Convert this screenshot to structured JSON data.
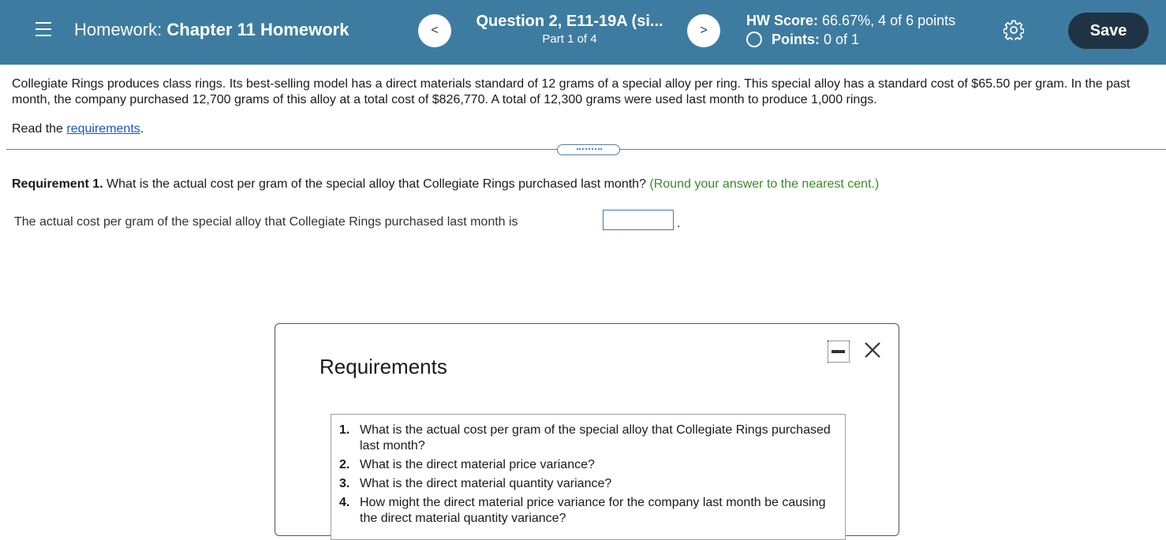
{
  "header": {
    "hw_prefix": "Homework:",
    "hw_title": "Chapter 11 Homework",
    "question_title": "Question 2, E11-19A (si...",
    "question_part": "Part 1 of 4",
    "prev_symbol": "<",
    "next_symbol": ">",
    "hw_score_label": "HW Score:",
    "hw_score_value": "66.67%, 4 of 6 points",
    "points_label": "Points:",
    "points_value": "0 of 1",
    "save_label": "Save",
    "icons": [
      "menu-icon",
      "chevron-left-icon",
      "chevron-right-icon",
      "gear-icon"
    ],
    "colors": {
      "bar": "#3d7ca0",
      "save_button": "#1f3344"
    }
  },
  "problem": {
    "text": "Collegiate Rings produces class rings. Its best-selling model has a direct materials standard of 12 grams of a special alloy per ring. This special alloy has a standard cost of $65.50 per gram. In the past month, the company purchased 12,700 grams of this alloy at a total cost of $826,770. A total of 12,300 grams were used last month to produce 1,000 rings.",
    "read_prefix": "Read the",
    "read_link": "requirements",
    "read_suffix": "."
  },
  "requirement1": {
    "label": "Requirement 1.",
    "question": "What is the actual cost per gram of the special alloy that Collegiate Rings purchased last month?",
    "hint": "(Round your answer to the nearest cent.)",
    "answer_prompt": "The actual cost per gram of the special alloy that Collegiate Rings purchased last month is",
    "answer_value": "",
    "answer_suffix": "."
  },
  "modal": {
    "title": "Requirements",
    "items": [
      {
        "num": "1.",
        "text": "What is the actual cost per gram of the special alloy that Collegiate Rings purchased last month?"
      },
      {
        "num": "2.",
        "text": "What is the direct material price variance?"
      },
      {
        "num": "3.",
        "text": "What is the direct material quantity variance?"
      },
      {
        "num": "4.",
        "text": "How might the direct material price variance for the company last month be causing the direct material quantity variance?"
      }
    ],
    "icons": [
      "minimize-icon",
      "close-icon"
    ]
  }
}
